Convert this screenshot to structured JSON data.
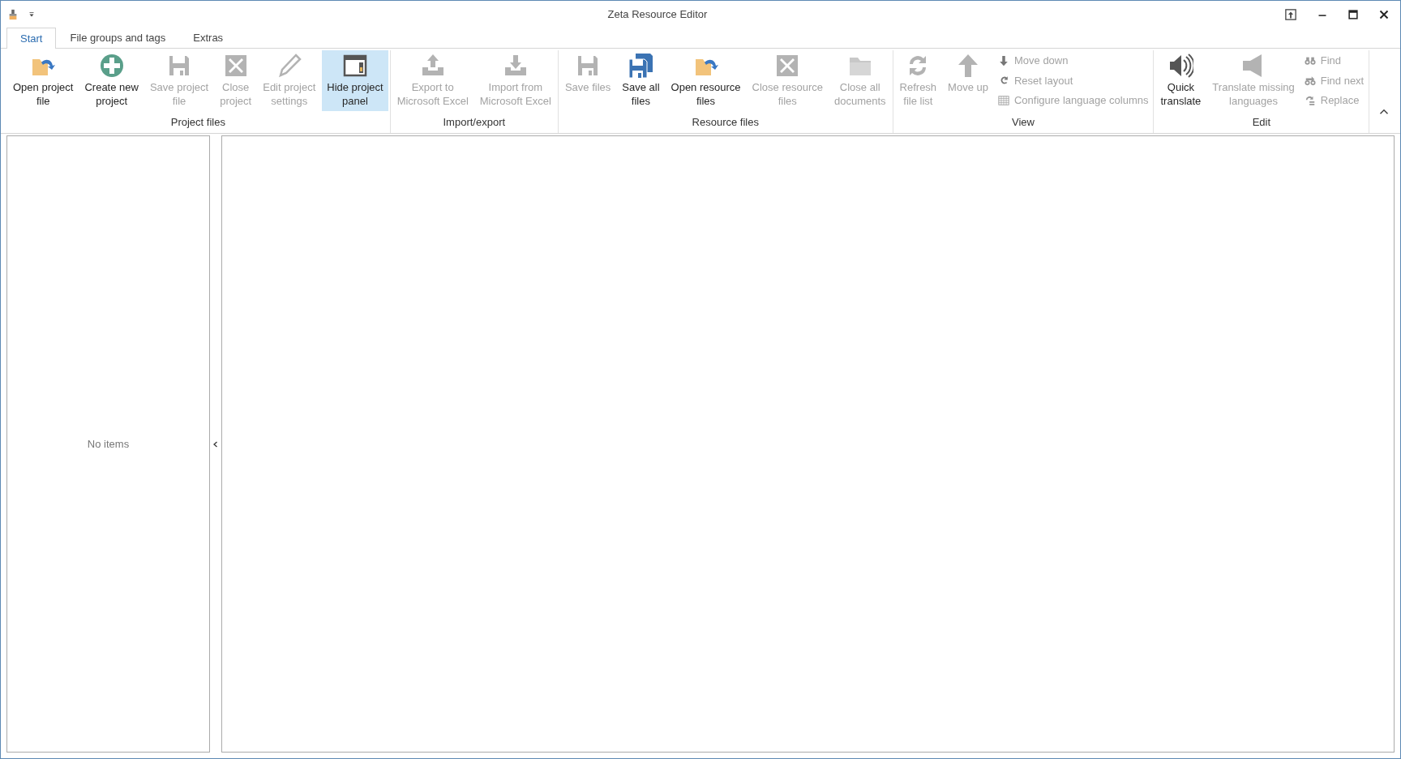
{
  "window": {
    "title": "Zeta Resource Editor"
  },
  "tabs": [
    {
      "label": "Start",
      "selected": true
    },
    {
      "label": "File groups and tags",
      "selected": false
    },
    {
      "label": "Extras",
      "selected": false
    }
  ],
  "ribbon": {
    "groups": [
      {
        "label": "Project files",
        "items": [
          {
            "kind": "large",
            "label": "Open project\nfile",
            "disabled": false,
            "pressed": false
          },
          {
            "kind": "large",
            "label": "Create new\nproject",
            "disabled": false,
            "pressed": false
          },
          {
            "kind": "large",
            "label": "Save project\nfile",
            "disabled": true,
            "pressed": false
          },
          {
            "kind": "large",
            "label": "Close\nproject",
            "disabled": true,
            "pressed": false
          },
          {
            "kind": "large",
            "label": "Edit project\nsettings",
            "disabled": true,
            "pressed": false
          },
          {
            "kind": "large",
            "label": "Hide project\npanel",
            "disabled": false,
            "pressed": true
          }
        ]
      },
      {
        "label": "Import/export",
        "items": [
          {
            "kind": "large",
            "label": "Export to\nMicrosoft Excel",
            "disabled": true,
            "pressed": false
          },
          {
            "kind": "large",
            "label": "Import from\nMicrosoft Excel",
            "disabled": true,
            "pressed": false
          }
        ]
      },
      {
        "label": "Resource files",
        "items": [
          {
            "kind": "large",
            "label": "Save files",
            "disabled": true,
            "pressed": false
          },
          {
            "kind": "large",
            "label": "Save all\nfiles",
            "disabled": false,
            "pressed": false
          },
          {
            "kind": "large",
            "label": "Open resource\nfiles",
            "disabled": false,
            "pressed": false
          },
          {
            "kind": "large",
            "label": "Close resource\nfiles",
            "disabled": true,
            "pressed": false
          },
          {
            "kind": "large",
            "label": "Close all\ndocuments",
            "disabled": true,
            "pressed": false
          }
        ]
      },
      {
        "label": "View",
        "items": [
          {
            "kind": "large",
            "label": "Refresh\nfile list",
            "disabled": true,
            "pressed": false
          },
          {
            "kind": "large",
            "label": "Move up",
            "disabled": true,
            "pressed": false
          },
          {
            "kind": "small",
            "label": "Move down",
            "disabled": true,
            "pressed": false
          },
          {
            "kind": "small",
            "label": "Reset layout",
            "disabled": true,
            "pressed": false
          },
          {
            "kind": "small",
            "label": "Configure language columns",
            "disabled": true,
            "pressed": false
          }
        ]
      },
      {
        "label": "Edit",
        "items": [
          {
            "kind": "large",
            "label": "Quick\ntranslate",
            "disabled": false,
            "pressed": false
          },
          {
            "kind": "large",
            "label": "Translate missing\nlanguages",
            "disabled": true,
            "pressed": false
          },
          {
            "kind": "small",
            "label": "Find",
            "disabled": true,
            "pressed": false
          },
          {
            "kind": "small",
            "label": "Find next",
            "disabled": true,
            "pressed": false
          },
          {
            "kind": "small",
            "label": "Replace",
            "disabled": true,
            "pressed": false
          }
        ]
      }
    ]
  },
  "project_panel": {
    "empty_text": "No items"
  }
}
